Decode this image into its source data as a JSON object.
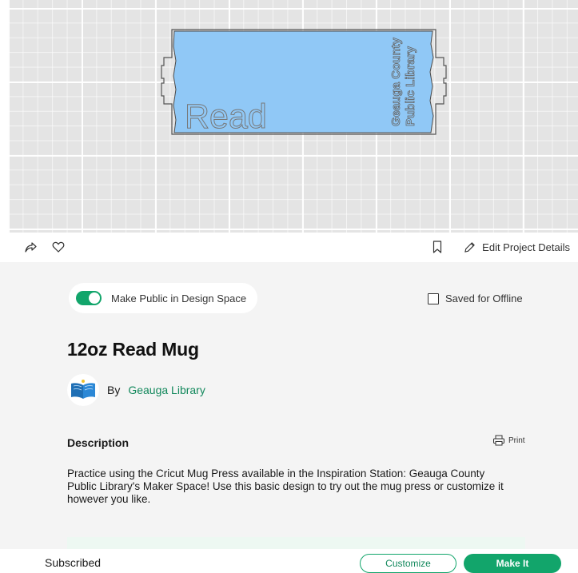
{
  "canvas": {
    "design_text_left": "Read",
    "design_text_right_line1": "Geauga County",
    "design_text_right_line2": "Public Library",
    "design_fill": "#90c8f6",
    "grid_color": "#e4e4e4"
  },
  "actions": {
    "share_icon": "share-arrow-icon",
    "like_icon": "heart-icon",
    "bookmark_icon": "bookmark-icon",
    "edit_icon": "pencil-icon",
    "edit_label": "Edit Project Details"
  },
  "details": {
    "public_toggle_label": "Make Public in Design Space",
    "public_toggle_on": true,
    "offline_label": "Saved for Offline",
    "offline_checked": false,
    "title": "12oz Read Mug",
    "by_label": "By",
    "author_name": "Geauga Library",
    "description_heading": "Description",
    "print_label": "Print",
    "description": "Practice using the Cricut Mug Press available in the Inspiration Station: Geauga County Public Library's Maker Space! Use this basic design to try out the mug press or customize it however you like."
  },
  "footer": {
    "status": "Subscribed",
    "customize_label": "Customize",
    "make_label": "Make It"
  },
  "colors": {
    "accent": "#12a56b",
    "accent_text": "#12885c",
    "panel_bg": "#f4f4f4"
  }
}
